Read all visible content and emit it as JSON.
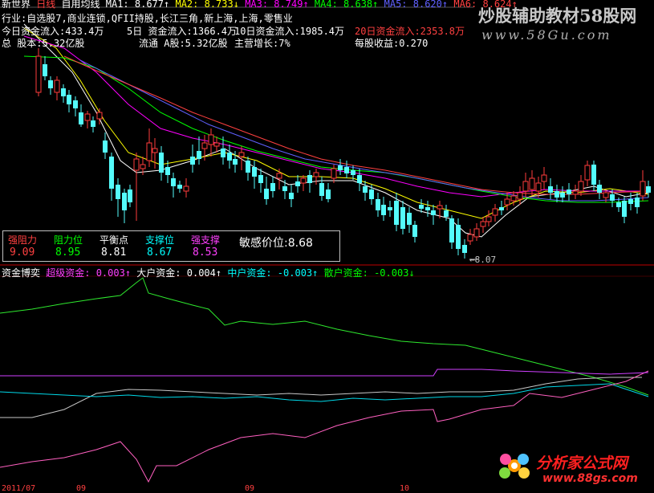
{
  "colors": {
    "bg": "#000000",
    "up": "#ff3c3c",
    "down": "#54fcfc",
    "ma1": "#ffffff",
    "ma2": "#ffff00",
    "ma3": "#ff00ff",
    "ma4": "#00ff00",
    "ma5": "#6060ff",
    "ma6": "#ff4040",
    "divider": "#c00000",
    "label_red": "#ff4040",
    "label_green": "#00ff00",
    "label_cyan": "#00ffff",
    "label_pink": "#ff40ff"
  },
  "header": {
    "row1": {
      "title": "新世界",
      "period": "日线",
      "indicator": "自用均线",
      "ma": [
        {
          "label": "MA1: 8.677",
          "arrow": "↑"
        },
        {
          "label": "MA2: 8.733",
          "arrow": "↓"
        },
        {
          "label": "MA3: 8.749",
          "arrow": "↑"
        },
        {
          "label": "MA4: 8.638",
          "arrow": "↑"
        },
        {
          "label": "MA5: 8.620",
          "arrow": "↑"
        },
        {
          "label": "MA6: 8.624",
          "arrow": "↑"
        }
      ]
    },
    "row2": "行业:自选股7,商业连锁,QFII持股,长江三角,新上海,上海,零售业",
    "row3": [
      {
        "text": "今日资金流入:433.4万",
        "color": "#ffffff"
      },
      {
        "text": "5日 资金流入:1366.4万",
        "color": "#ffffff"
      },
      {
        "text": "10日资金流入:1985.4万",
        "color": "#ffffff"
      },
      {
        "text": "20日资金流入:2353.8万",
        "color": "#ff4040"
      }
    ],
    "row4": [
      {
        "text": "总 股本:5.32亿股",
        "color": "#ffffff"
      },
      {
        "text": "流通 A股:5.32亿股",
        "color": "#ffffff"
      },
      {
        "text": "主营增长:7%",
        "color": "#ffffff"
      },
      {
        "text": "每股收益:0.270",
        "color": "#ffffff"
      }
    ]
  },
  "levels_box": {
    "items": [
      {
        "label": "强阻力",
        "value": "9.09",
        "color": "#ff4040"
      },
      {
        "label": "阻力位",
        "value": "8.95",
        "color": "#00ff00"
      },
      {
        "label": "平衡点",
        "value": "8.81",
        "color": "#ffffff"
      },
      {
        "label": "支撑位",
        "value": "8.67",
        "color": "#00ffff"
      },
      {
        "label": "强支撑",
        "value": "8.53",
        "color": "#ff40ff"
      }
    ],
    "sensitive": "敏感价位:8.68"
  },
  "low_marker": "8.07",
  "sub_header": {
    "title": "资金博奕",
    "items": [
      {
        "label": "超级资金: 0.003",
        "arrow": "↑",
        "color": "#ff40ff"
      },
      {
        "label": "大户资金: 0.004",
        "arrow": "↑",
        "color": "#ffffff"
      },
      {
        "label": "中户资金: -0.003",
        "arrow": "↑",
        "color": "#00ffff"
      },
      {
        "label": "散户资金: -0.003",
        "arrow": "↓",
        "color": "#00ff00"
      }
    ]
  },
  "watermarks": {
    "top": "炒股辅助教材58股网",
    "top_url": "www.58Gu.com",
    "bottom": "分析家公式网",
    "bottom_url": "www.88gs.com"
  },
  "axis_labels": [
    "2011/07",
    "09",
    "09",
    "10"
  ]
}
